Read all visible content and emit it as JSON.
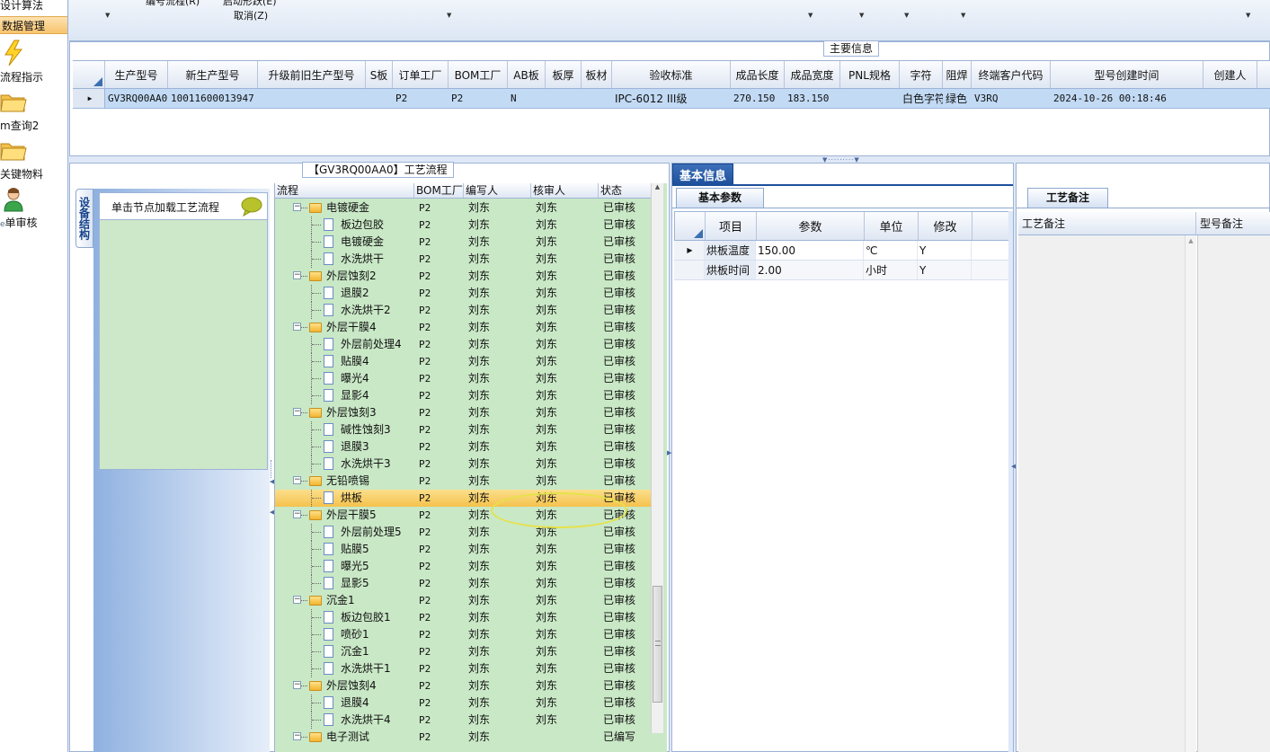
{
  "nav": {
    "items": [
      {
        "label": "设计算法",
        "icon": ""
      },
      {
        "label": "数据管理",
        "icon": "",
        "selected": true
      },
      {
        "label": "流程指示",
        "icon": "lightning-icon"
      },
      {
        "label": "m查询2",
        "icon": "folder-icon"
      },
      {
        "label": "关键物料",
        "icon": "folder-icon"
      },
      {
        "label": "单审核",
        "icon": "user-icon"
      }
    ]
  },
  "toolbar": {
    "text1": "编号流程(R)",
    "text2": "启动形跃(E)",
    "text3": "取消(Z)"
  },
  "main_info": {
    "group_label": "主要信息",
    "columns": [
      "生产型号",
      "新生产型号",
      "升级前旧生产型号",
      "S板",
      "订单工厂",
      "BOM工厂",
      "AB板",
      "板厚",
      "板材",
      "验收标准",
      "成品长度",
      "成品宽度",
      "PNL规格",
      "字符",
      "阻焊",
      "终端客户代码",
      "型号创建时间",
      "创建人"
    ],
    "row": [
      "GV3RQ00AA0",
      "10011600013947",
      "",
      "",
      "P2",
      "P2",
      "N",
      "",
      "",
      "IPC-6012 III级",
      "270.150",
      "183.150",
      "",
      "白色字符",
      "绿色",
      "V3RQ",
      "2024-10-26 00:18:46",
      ""
    ]
  },
  "process": {
    "group_label": "【GV3RQ00AA0】工艺流程",
    "vertical_tab": "设备结构",
    "hint": "单击节点加载工艺流程",
    "columns": [
      "流程",
      "BOM工厂",
      "编写人",
      "核审人",
      "状态"
    ],
    "rows": [
      {
        "name": "电镀硬金",
        "level": 0,
        "bom": "P2",
        "writer": "刘东",
        "checker": "刘东",
        "status": "已审核"
      },
      {
        "name": "板边包胶",
        "level": 1,
        "bom": "P2",
        "writer": "刘东",
        "checker": "刘东",
        "status": "已审核"
      },
      {
        "name": "电镀硬金",
        "level": 1,
        "bom": "P2",
        "writer": "刘东",
        "checker": "刘东",
        "status": "已审核"
      },
      {
        "name": "水洗烘干",
        "level": 1,
        "bom": "P2",
        "writer": "刘东",
        "checker": "刘东",
        "status": "已审核"
      },
      {
        "name": "外层蚀刻2",
        "level": 0,
        "bom": "P2",
        "writer": "刘东",
        "checker": "刘东",
        "status": "已审核"
      },
      {
        "name": "退膜2",
        "level": 1,
        "bom": "P2",
        "writer": "刘东",
        "checker": "刘东",
        "status": "已审核"
      },
      {
        "name": "水洗烘干2",
        "level": 1,
        "bom": "P2",
        "writer": "刘东",
        "checker": "刘东",
        "status": "已审核"
      },
      {
        "name": "外层干膜4",
        "level": 0,
        "bom": "P2",
        "writer": "刘东",
        "checker": "刘东",
        "status": "已审核"
      },
      {
        "name": "外层前处理4",
        "level": 1,
        "bom": "P2",
        "writer": "刘东",
        "checker": "刘东",
        "status": "已审核"
      },
      {
        "name": "贴膜4",
        "level": 1,
        "bom": "P2",
        "writer": "刘东",
        "checker": "刘东",
        "status": "已审核"
      },
      {
        "name": "曝光4",
        "level": 1,
        "bom": "P2",
        "writer": "刘东",
        "checker": "刘东",
        "status": "已审核"
      },
      {
        "name": "显影4",
        "level": 1,
        "bom": "P2",
        "writer": "刘东",
        "checker": "刘东",
        "status": "已审核"
      },
      {
        "name": "外层蚀刻3",
        "level": 0,
        "bom": "P2",
        "writer": "刘东",
        "checker": "刘东",
        "status": "已审核"
      },
      {
        "name": "碱性蚀刻3",
        "level": 1,
        "bom": "P2",
        "writer": "刘东",
        "checker": "刘东",
        "status": "已审核"
      },
      {
        "name": "退膜3",
        "level": 1,
        "bom": "P2",
        "writer": "刘东",
        "checker": "刘东",
        "status": "已审核"
      },
      {
        "name": "水洗烘干3",
        "level": 1,
        "bom": "P2",
        "writer": "刘东",
        "checker": "刘东",
        "status": "已审核"
      },
      {
        "name": "无铅喷锡",
        "level": 0,
        "bom": "P2",
        "writer": "刘东",
        "checker": "刘东",
        "status": "已审核"
      },
      {
        "name": "烘板",
        "level": 1,
        "bom": "P2",
        "writer": "刘东",
        "checker": "刘东",
        "status": "已审核",
        "selected": true
      },
      {
        "name": "外层干膜5",
        "level": 0,
        "bom": "P2",
        "writer": "刘东",
        "checker": "刘东",
        "status": "已审核"
      },
      {
        "name": "外层前处理5",
        "level": 1,
        "bom": "P2",
        "writer": "刘东",
        "checker": "刘东",
        "status": "已审核"
      },
      {
        "name": "贴膜5",
        "level": 1,
        "bom": "P2",
        "writer": "刘东",
        "checker": "刘东",
        "status": "已审核"
      },
      {
        "name": "曝光5",
        "level": 1,
        "bom": "P2",
        "writer": "刘东",
        "checker": "刘东",
        "status": "已审核"
      },
      {
        "name": "显影5",
        "level": 1,
        "bom": "P2",
        "writer": "刘东",
        "checker": "刘东",
        "status": "已审核"
      },
      {
        "name": "沉金1",
        "level": 0,
        "bom": "P2",
        "writer": "刘东",
        "checker": "刘东",
        "status": "已审核"
      },
      {
        "name": "板边包胶1",
        "level": 1,
        "bom": "P2",
        "writer": "刘东",
        "checker": "刘东",
        "status": "已审核"
      },
      {
        "name": "喷砂1",
        "level": 1,
        "bom": "P2",
        "writer": "刘东",
        "checker": "刘东",
        "status": "已审核"
      },
      {
        "name": "沉金1",
        "level": 1,
        "bom": "P2",
        "writer": "刘东",
        "checker": "刘东",
        "status": "已审核"
      },
      {
        "name": "水洗烘干1",
        "level": 1,
        "bom": "P2",
        "writer": "刘东",
        "checker": "刘东",
        "status": "已审核"
      },
      {
        "name": "外层蚀刻4",
        "level": 0,
        "bom": "P2",
        "writer": "刘东",
        "checker": "刘东",
        "status": "已审核"
      },
      {
        "name": "退膜4",
        "level": 1,
        "bom": "P2",
        "writer": "刘东",
        "checker": "刘东",
        "status": "已审核"
      },
      {
        "name": "水洗烘干4",
        "level": 1,
        "bom": "P2",
        "writer": "刘东",
        "checker": "刘东",
        "status": "已审核"
      },
      {
        "name": "电子测试",
        "level": 0,
        "bom": "P2",
        "writer": "刘东",
        "checker": "",
        "status": "已编写"
      }
    ]
  },
  "basic_info": {
    "tab": "基本信息",
    "subtab": "基本参数",
    "columns": [
      "项目",
      "参数",
      "单位",
      "修改"
    ],
    "rows": [
      {
        "item": "烘板温度",
        "param": "150.00",
        "unit": "℃",
        "mod": "Y"
      },
      {
        "item": "烘板时间",
        "param": "2.00",
        "unit": "小时",
        "mod": "Y"
      }
    ]
  },
  "remarks": {
    "tab": "工艺备注",
    "col1": "工艺备注",
    "col2": "型号备注"
  },
  "colors": {
    "selection": "#f5c24c",
    "tree_bg": "#c9e8c6",
    "row_selected": "#c2daf4",
    "tab_blue": "#1d4f9b"
  }
}
